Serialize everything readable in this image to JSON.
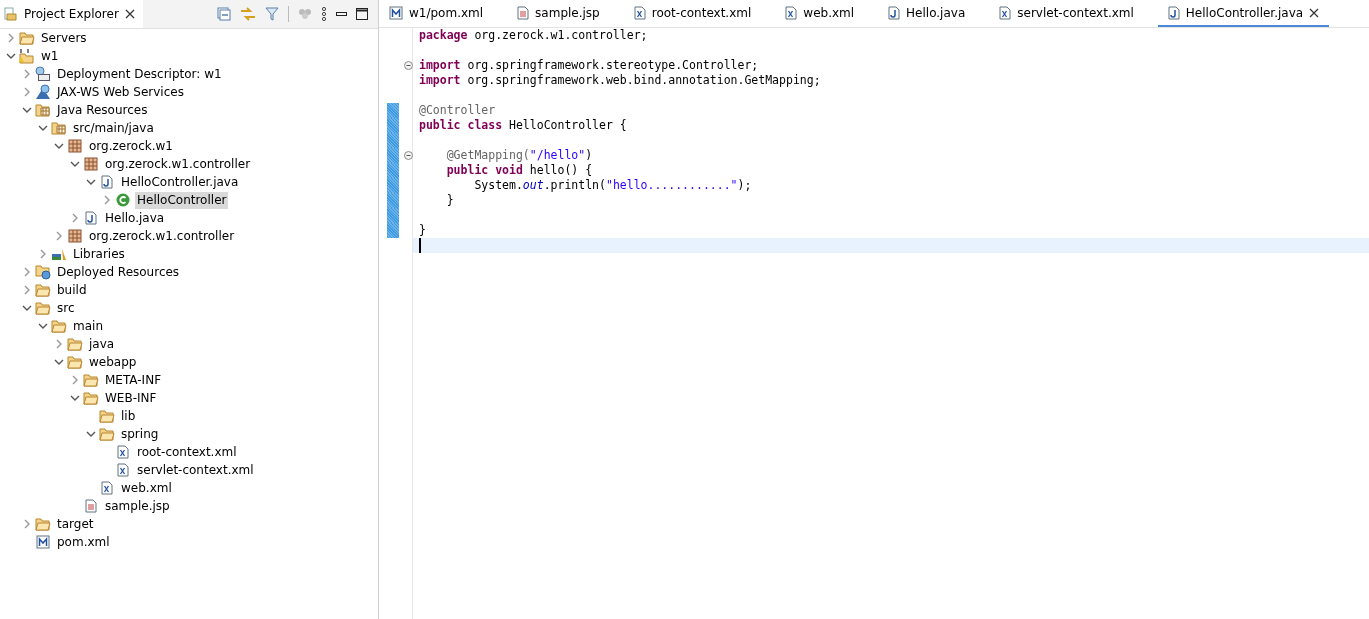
{
  "explorer": {
    "title": "Project Explorer",
    "tree": [
      {
        "label": "Servers",
        "kind": "folder-open",
        "expanded": false,
        "selected": false
      },
      {
        "label": "w1",
        "kind": "project",
        "expanded": true,
        "selected": false,
        "children": [
          {
            "label": "Deployment Descriptor: w1",
            "kind": "descriptor",
            "expanded": false,
            "selected": false
          },
          {
            "label": "JAX-WS Web Services",
            "kind": "webservice",
            "expanded": false,
            "selected": false
          },
          {
            "label": "Java Resources",
            "kind": "javares",
            "expanded": true,
            "selected": false,
            "children": [
              {
                "label": "src/main/java",
                "kind": "srcfolder",
                "expanded": true,
                "selected": false,
                "children": [
                  {
                    "label": "org.zerock.w1",
                    "kind": "package",
                    "expanded": true,
                    "selected": false,
                    "children": [
                      {
                        "label": "org.zerock.w1.controller",
                        "kind": "package",
                        "expanded": true,
                        "selected": false,
                        "children": [
                          {
                            "label": "HelloController.java",
                            "kind": "java",
                            "expanded": true,
                            "selected": false,
                            "children": [
                              {
                                "label": "HelloController",
                                "kind": "class",
                                "expanded": false,
                                "selected": true
                              }
                            ]
                          }
                        ]
                      },
                      {
                        "label": "Hello.java",
                        "kind": "java",
                        "expanded": false,
                        "selected": false
                      }
                    ]
                  },
                  {
                    "label": "org.zerock.w1.controller",
                    "kind": "package",
                    "expanded": false,
                    "selected": false
                  }
                ]
              },
              {
                "label": "Libraries",
                "kind": "library",
                "expanded": false,
                "selected": false
              }
            ]
          },
          {
            "label": "Deployed Resources",
            "kind": "deployed",
            "expanded": false,
            "selected": false
          },
          {
            "label": "build",
            "kind": "folder",
            "expanded": false,
            "selected": false
          },
          {
            "label": "src",
            "kind": "folder",
            "expanded": true,
            "selected": false,
            "children": [
              {
                "label": "main",
                "kind": "folder",
                "expanded": true,
                "selected": false,
                "children": [
                  {
                    "label": "java",
                    "kind": "folder",
                    "expanded": false,
                    "selected": false
                  },
                  {
                    "label": "webapp",
                    "kind": "folder",
                    "expanded": true,
                    "selected": false,
                    "children": [
                      {
                        "label": "META-INF",
                        "kind": "folder",
                        "expanded": false,
                        "selected": false
                      },
                      {
                        "label": "WEB-INF",
                        "kind": "folder",
                        "expanded": true,
                        "selected": false,
                        "children": [
                          {
                            "label": "lib",
                            "kind": "folder",
                            "selected": false
                          },
                          {
                            "label": "spring",
                            "kind": "folder",
                            "expanded": true,
                            "selected": false,
                            "children": [
                              {
                                "label": "root-context.xml",
                                "kind": "xml",
                                "selected": false
                              },
                              {
                                "label": "servlet-context.xml",
                                "kind": "xml",
                                "selected": false
                              }
                            ]
                          },
                          {
                            "label": "web.xml",
                            "kind": "xml",
                            "selected": false
                          }
                        ]
                      },
                      {
                        "label": "sample.jsp",
                        "kind": "jsp",
                        "selected": false
                      }
                    ]
                  }
                ]
              }
            ]
          },
          {
            "label": "target",
            "kind": "folder",
            "expanded": false,
            "selected": false
          },
          {
            "label": "pom.xml",
            "kind": "maven",
            "selected": false
          }
        ]
      }
    ]
  },
  "editor": {
    "tabs": [
      {
        "label": "w1/pom.xml",
        "kind": "maven",
        "selected": false
      },
      {
        "label": "sample.jsp",
        "kind": "jsp",
        "selected": false
      },
      {
        "label": "root-context.xml",
        "kind": "xml",
        "selected": false
      },
      {
        "label": "web.xml",
        "kind": "xml",
        "selected": false
      },
      {
        "label": "Hello.java",
        "kind": "java",
        "selected": false
      },
      {
        "label": "servlet-context.xml",
        "kind": "xml",
        "selected": false
      },
      {
        "label": "HelloController.java",
        "kind": "java",
        "selected": true
      }
    ],
    "lines": [
      {
        "changed": false,
        "fold": false,
        "current": false,
        "tokens": [
          {
            "kind": "keyword",
            "text": "package"
          },
          {
            "kind": "plain",
            "text": " org.zerock.w1.controller;"
          }
        ]
      },
      {
        "changed": false,
        "fold": false,
        "current": false
      },
      {
        "changed": false,
        "fold": true,
        "current": false,
        "tokens": [
          {
            "kind": "keyword",
            "text": "import"
          },
          {
            "kind": "plain",
            "text": " org.springframework.stereotype.Controller;"
          }
        ]
      },
      {
        "changed": false,
        "fold": false,
        "current": false,
        "tokens": [
          {
            "kind": "keyword",
            "text": "import"
          },
          {
            "kind": "plain",
            "text": " org.springframework.web.bind.annotation.GetMapping;"
          }
        ]
      },
      {
        "changed": false,
        "fold": false,
        "current": false
      },
      {
        "changed": true,
        "fold": false,
        "current": false,
        "tokens": [
          {
            "kind": "annotation",
            "text": "@Controller"
          }
        ]
      },
      {
        "changed": true,
        "fold": false,
        "current": false,
        "tokens": [
          {
            "kind": "keyword",
            "text": "public "
          },
          {
            "kind": "keyword",
            "text": "class "
          },
          {
            "kind": "plain",
            "text": "HelloController {"
          }
        ]
      },
      {
        "changed": true,
        "fold": false,
        "current": false
      },
      {
        "changed": true,
        "fold": true,
        "current": false,
        "tokens": [
          {
            "kind": "annotation",
            "text": "    @GetMapping("
          },
          {
            "kind": "string",
            "text": "\"/hello\""
          },
          {
            "kind": "plain",
            "text": ")"
          }
        ]
      },
      {
        "changed": true,
        "fold": false,
        "current": false,
        "tokens": [
          {
            "kind": "keyword",
            "text": "    public "
          },
          {
            "kind": "keyword",
            "text": "void "
          },
          {
            "kind": "plain",
            "text": "hello() {"
          }
        ]
      },
      {
        "changed": true,
        "fold": false,
        "current": false,
        "tokens": [
          {
            "kind": "plain",
            "text": "        System."
          },
          {
            "kind": "static",
            "text": "out"
          },
          {
            "kind": "plain",
            "text": ".println("
          },
          {
            "kind": "string",
            "text": "\"hello............\""
          },
          {
            "kind": "plain",
            "text": ");"
          }
        ]
      },
      {
        "changed": true,
        "fold": false,
        "current": false,
        "tokens": [
          {
            "kind": "plain",
            "text": "    }"
          }
        ]
      },
      {
        "changed": true,
        "fold": false,
        "current": false
      },
      {
        "changed": true,
        "fold": false,
        "current": false,
        "tokens": [
          {
            "kind": "plain",
            "text": "}"
          }
        ]
      },
      {
        "changed": false,
        "fold": false,
        "current": true
      }
    ]
  }
}
